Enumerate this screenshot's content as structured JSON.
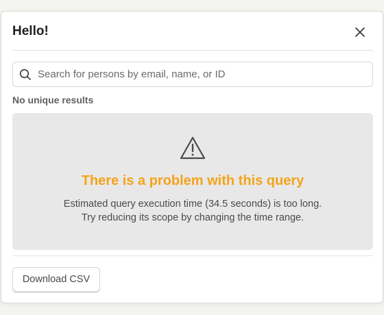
{
  "modal": {
    "title": "Hello!",
    "close_icon": "close-icon"
  },
  "search": {
    "icon": "search-icon",
    "placeholder": "Search for persons by email, name, or ID",
    "value": ""
  },
  "results": {
    "label": "No unique results"
  },
  "problem": {
    "icon": "warning-icon",
    "title": "There is a problem with this query",
    "message": "Estimated query execution time (34.5 seconds) is too long. Try reducing its scope by changing the time range.",
    "title_color": "#f5a31a"
  },
  "footer": {
    "download_label": "Download CSV"
  }
}
